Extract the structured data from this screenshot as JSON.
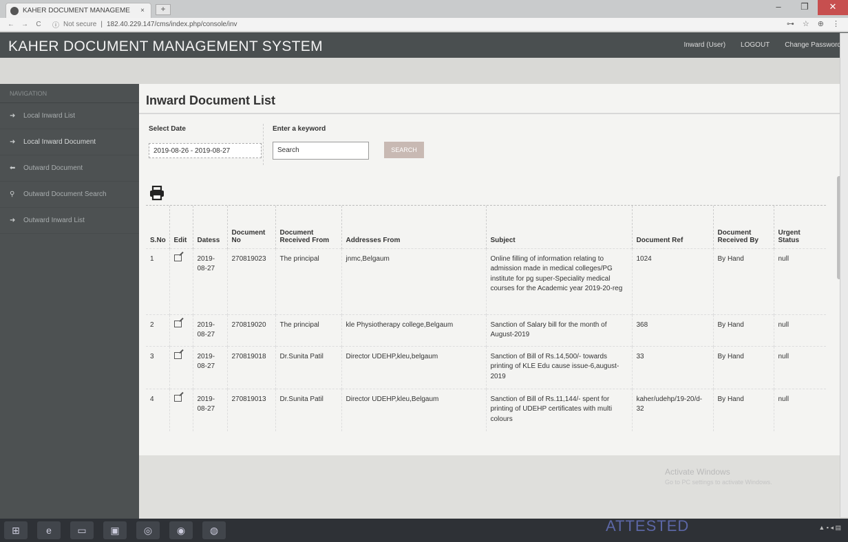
{
  "browser": {
    "tab_title": "KAHER DOCUMENT MANAGEME",
    "tab_close": "×",
    "new_tab": "+",
    "url_security": "Not secure",
    "url": "182.40.229.147/cms/index.php/console/inv",
    "win_min": "–",
    "win_max": "❐",
    "win_close": "✕"
  },
  "header": {
    "app_title": "KAHER DOCUMENT MANAGEMENT SYSTEM",
    "user_link": "Inward (User)",
    "logout_link": "LOGOUT",
    "change_password_link": "Change Password"
  },
  "sidebar": {
    "section_label": "NAVIGATION",
    "items": [
      {
        "label": "Local Inward List"
      },
      {
        "label": "Local Inward Document"
      },
      {
        "label": "Outward Document"
      },
      {
        "label": "Outward Document Search"
      },
      {
        "label": "Outward Inward List"
      }
    ]
  },
  "page": {
    "title": "Inward Document List",
    "select_date_label": "Select Date",
    "date_range": "2019-08-26 - 2019-08-27",
    "keyword_label": "Enter a keyword",
    "search_placeholder": "Search",
    "search_button": "SEARCH"
  },
  "table": {
    "headers": [
      "S.No",
      "Edit",
      "Datess",
      "Document No",
      "Document Received From",
      "Addresses From",
      "Subject",
      "Document Ref",
      "Document Received By",
      "Urgent Status"
    ],
    "rows": [
      {
        "sno": "1",
        "date": "2019-08-27",
        "doc_no": "270819023",
        "received_from": "The principal",
        "address_from": "jnmc,Belgaum",
        "subject": "Online filling of information relating to admission made in medical colleges/PG institute for pg super-Speciality medical courses for the Academic year 2019-20-reg",
        "doc_ref": "1024",
        "received_by": "By Hand",
        "urgent": "null"
      },
      {
        "sno": "2",
        "date": "2019-08-27",
        "doc_no": "270819020",
        "received_from": "The principal",
        "address_from": "kle Physiotherapy college,Belgaum",
        "subject": "Sanction of Salary bill for the month of August-2019",
        "doc_ref": "368",
        "received_by": "By Hand",
        "urgent": "null"
      },
      {
        "sno": "3",
        "date": "2019-08-27",
        "doc_no": "270819018",
        "received_from": "Dr.Sunita Patil",
        "address_from": "Director UDEHP,kleu,belgaum",
        "subject": "Sanction of Bill of Rs.14,500/- towards printing of KLE Edu cause issue-6,august-2019",
        "doc_ref": "33",
        "received_by": "By Hand",
        "urgent": "null"
      },
      {
        "sno": "4",
        "date": "2019-08-27",
        "doc_no": "270819013",
        "received_from": "Dr.Sunita Patil",
        "address_from": "Director UDEHP,kleu,Belgaum",
        "subject": "Sanction of Bill of Rs.11,144/- spent for printing of UDEHP certificates with multi colours",
        "doc_ref": "kaher/udehp/19-20/d-32",
        "received_by": "By Hand",
        "urgent": "null"
      }
    ]
  },
  "overlay": {
    "activate_title": "Activate Windows",
    "activate_sub": "Go to PC settings to activate Windows.",
    "stamp": "ATTESTED"
  }
}
